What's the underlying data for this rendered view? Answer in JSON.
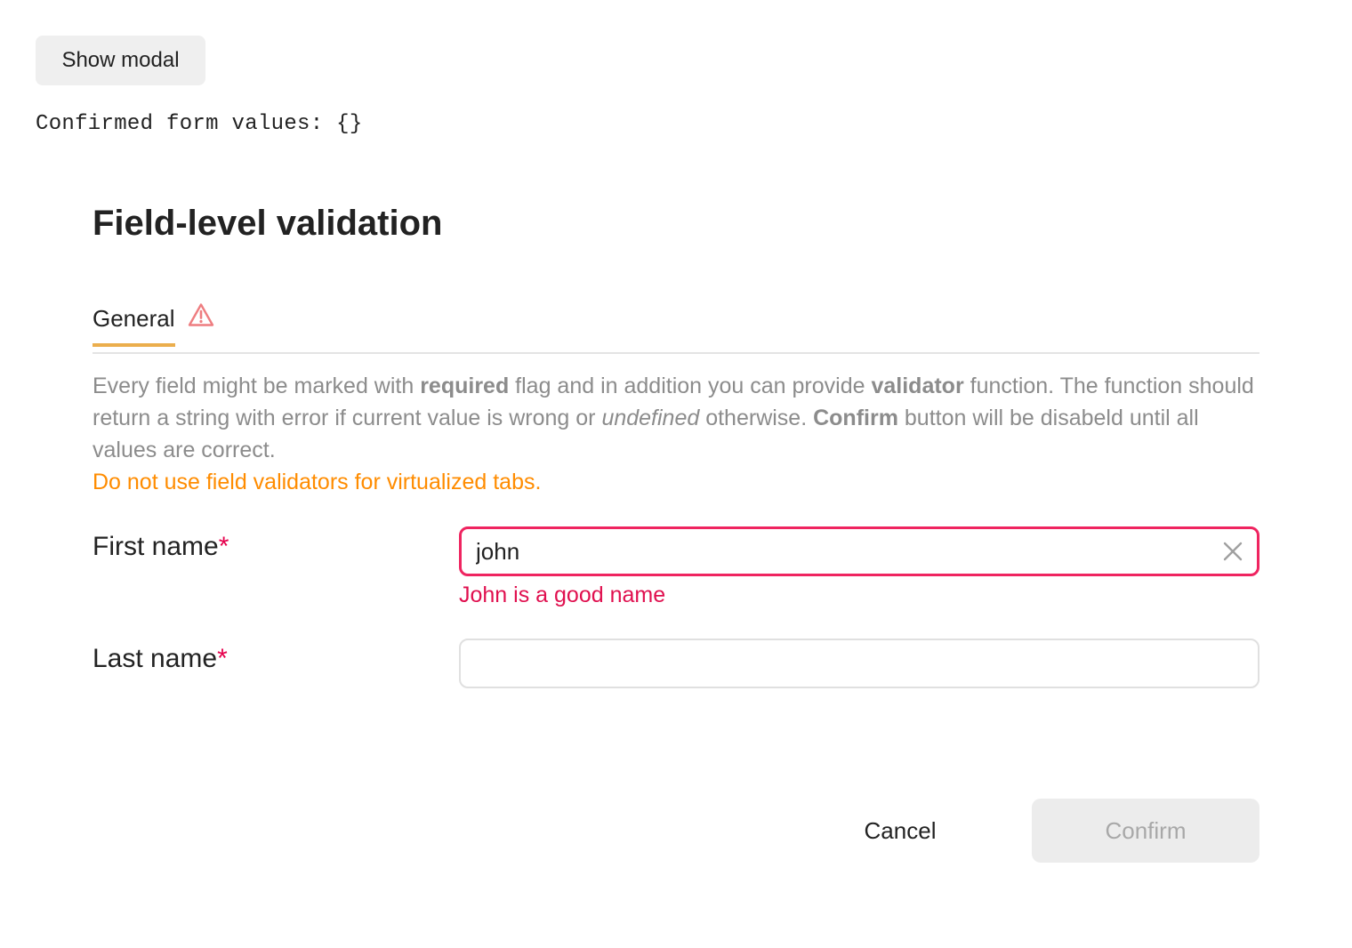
{
  "page": {
    "show_modal_label": "Show modal",
    "confirmed_values_text": "Confirmed form values: {}"
  },
  "modal": {
    "title": "Field-level validation",
    "tabs": [
      {
        "label": "General",
        "active": true,
        "has_warning": true,
        "warning_icon": "warning-triangle-icon"
      }
    ],
    "description": {
      "part1": "Every field might be marked with ",
      "required_word": "required",
      "part2": " flag and in addition you can provide ",
      "validator_word": "validator",
      "part3": " function. The function should return a string with error if current value is wrong or ",
      "undefined_word": "undefined",
      "part4": " otherwise. ",
      "confirm_word": "Confirm",
      "part5": " button will be disabeld until all values are correct.",
      "warning": "Do not use field validators for virtualized tabs."
    },
    "fields": {
      "first_name": {
        "label": "First name",
        "required_mark": "*",
        "value": "john",
        "error": "John is a good name",
        "clear_icon": "close-icon"
      },
      "last_name": {
        "label": "Last name",
        "required_mark": "*",
        "value": ""
      }
    },
    "footer": {
      "cancel_label": "Cancel",
      "confirm_label": "Confirm",
      "confirm_disabled": true
    }
  },
  "colors": {
    "tab_underline": "#ebae4d",
    "warning_text": "#ff8c00",
    "error": "#ef2460",
    "required_mark": "#e6004c",
    "warning_icon": "#ee7d80"
  }
}
